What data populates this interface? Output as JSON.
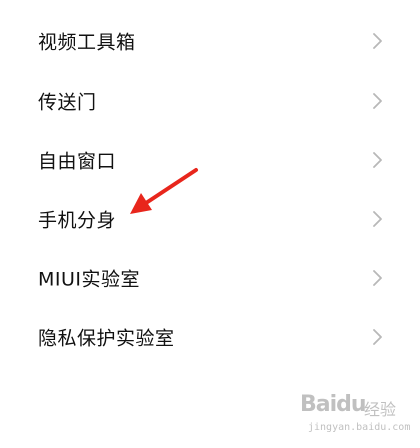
{
  "menu": {
    "items": [
      {
        "label": "视频工具箱"
      },
      {
        "label": "传送门"
      },
      {
        "label": "自由窗口"
      },
      {
        "label": "手机分身"
      },
      {
        "label": "MIUI实验室"
      },
      {
        "label": "隐私保护实验室"
      }
    ]
  },
  "annotation": {
    "arrow_color": "#e8261c",
    "points_to": "手机分身"
  },
  "watermark": {
    "brand": "Baidu",
    "jingyan": "经验",
    "url": "jingyan.baidu.com"
  },
  "colors": {
    "background": "#ffffff",
    "label": "#111111",
    "chevron": "#b8b8b8"
  }
}
